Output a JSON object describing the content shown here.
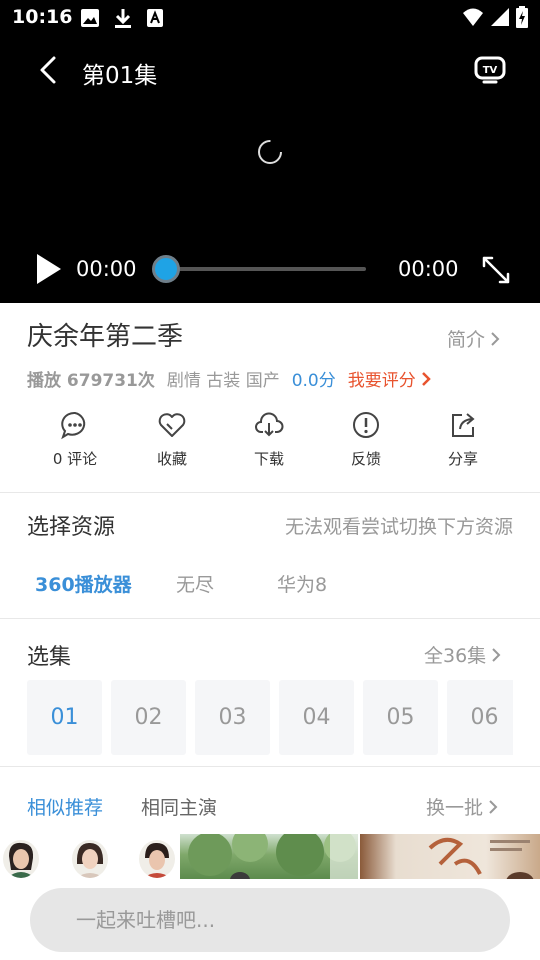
{
  "status_bar": {
    "time": "10:16",
    "icons": [
      "image-icon",
      "download-icon",
      "a-icon"
    ],
    "right_icons": [
      "wifi-icon",
      "signal-icon",
      "battery-icon"
    ]
  },
  "player": {
    "episode_title": "第01集",
    "current_time": "00:00",
    "duration": "00:00",
    "progress": 0
  },
  "info": {
    "title": "庆余年第二季",
    "intro_label": "简介",
    "play_label": "播放 679731次",
    "tags": "剧情 古装 国产",
    "score": "0.0分",
    "rate_label": "我要评分"
  },
  "actions": [
    {
      "icon": "comment-icon",
      "label": "0 评论"
    },
    {
      "icon": "heart-icon",
      "label": "收藏"
    },
    {
      "icon": "cloud-download-icon",
      "label": "下载"
    },
    {
      "icon": "feedback-icon",
      "label": "反馈"
    },
    {
      "icon": "share-icon",
      "label": "分享"
    }
  ],
  "sources": {
    "title": "选择资源",
    "note": "无法观看尝试切换下方资源",
    "tabs": [
      "360播放器",
      "无尽",
      "华为8"
    ],
    "active": 0
  },
  "episodes": {
    "title": "选集",
    "all_label": "全36集",
    "items": [
      "01",
      "02",
      "03",
      "04",
      "05",
      "06"
    ],
    "active": 0
  },
  "recommend": {
    "tabs": [
      "相似推荐",
      "相同主演"
    ],
    "refresh_label": "换一批"
  },
  "comment": {
    "placeholder": "一起来吐槽吧..."
  },
  "colors": {
    "accent": "#3a8fd8",
    "rate": "#e8532e",
    "knob": "#1fa3e5"
  }
}
